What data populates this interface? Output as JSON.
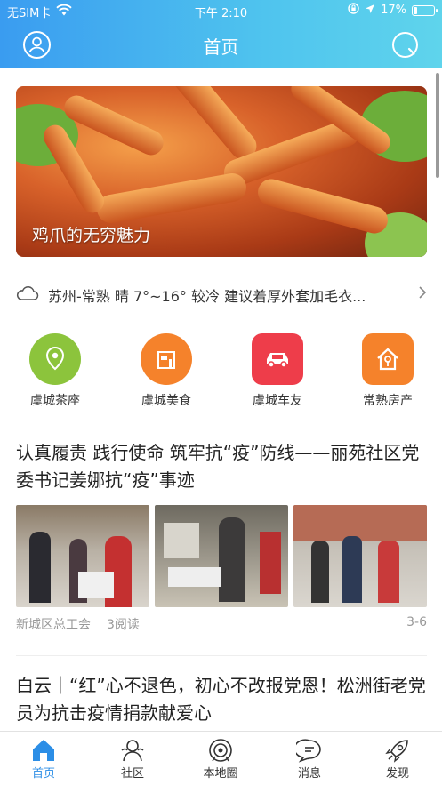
{
  "status_bar": {
    "carrier": "无SIM卡",
    "time": "下午 2:10",
    "battery": "17%",
    "battery_level": 0.17
  },
  "navbar": {
    "title": "首页"
  },
  "banner": {
    "caption": "鸡爪的无穷魅力"
  },
  "weather": {
    "text": "苏州-常熟 晴 7°~16° 较冷 建议着厚外套加毛衣..."
  },
  "quick_links": [
    {
      "label": "虞城茶座",
      "icon": "location-pin-icon",
      "color": "#8cc43c"
    },
    {
      "label": "虞城美食",
      "icon": "shop-icon",
      "color": "#f5822b"
    },
    {
      "label": "虞城车友",
      "icon": "car-icon",
      "color": "#ee3d4a"
    },
    {
      "label": "常熟房产",
      "icon": "house-icon",
      "color": "#f5822b"
    }
  ],
  "articles": [
    {
      "title": "认真履责 践行使命 筑牢抗“疫”防线——丽苑社区党委书记姜娜抗“疫”事迹",
      "source": "新城区总工会",
      "reads": "3阅读",
      "date": "3-6"
    },
    {
      "title": "白云｜“红”心不退色，初心不改报党恩！松洲街老党员为抗击疫情捐款献爱心"
    }
  ],
  "tabs": [
    {
      "label": "首页",
      "icon": "home-icon",
      "active": true
    },
    {
      "label": "社区",
      "icon": "community-icon",
      "active": false
    },
    {
      "label": "本地圈",
      "icon": "local-circle-icon",
      "active": false
    },
    {
      "label": "消息",
      "icon": "message-icon",
      "active": false
    },
    {
      "label": "发现",
      "icon": "rocket-icon",
      "active": false
    }
  ],
  "colors": {
    "accent": "#2c8ee6",
    "header_start": "#3a9cf0",
    "header_end": "#5fd4ec"
  }
}
